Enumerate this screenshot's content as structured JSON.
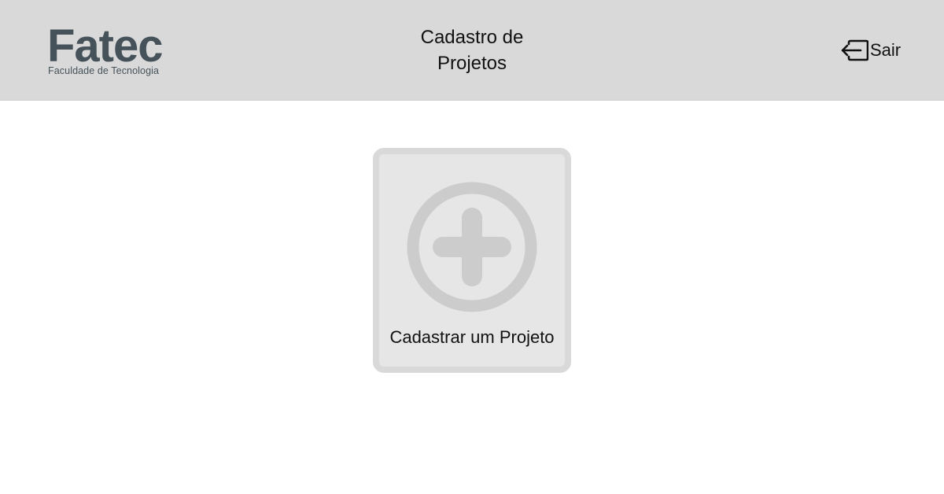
{
  "header": {
    "logo": {
      "word": "Fatec",
      "subtitle": "Faculdade de Tecnologia"
    },
    "title": "Cadastro de Projetos",
    "logout": {
      "icon": "logout-icon",
      "label": "Sair"
    }
  },
  "main": {
    "create_card": {
      "icon": "plus-circle-icon",
      "label": "Cadastrar um Projeto"
    }
  },
  "colors": {
    "header_bg": "#d9d9d9",
    "logo": "#46525a",
    "card_bg": "#e6e6e6",
    "card_border": "#d9d9d9",
    "icon": "#cccccc",
    "text": "#111111"
  }
}
